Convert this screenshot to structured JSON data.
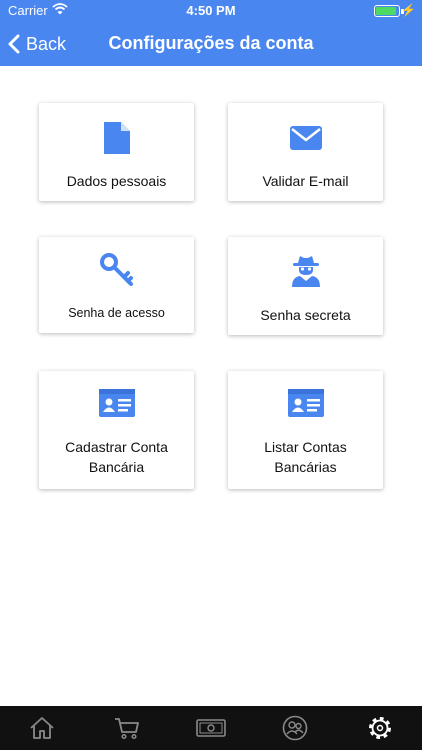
{
  "status_bar": {
    "carrier": "Carrier",
    "time": "4:50 PM",
    "battery_level": 0.95
  },
  "navbar": {
    "back_label": "Back",
    "title": "Configurações da conta"
  },
  "cards": [
    {
      "label": "Dados pessoais",
      "icon": "document-icon"
    },
    {
      "label": "Validar E-mail",
      "icon": "envelope-icon"
    },
    {
      "label": "Senha de acesso",
      "icon": "key-icon"
    },
    {
      "label": "Senha secreta",
      "icon": "spy-icon"
    },
    {
      "label": "Cadastrar Conta Bancária",
      "icon": "id-card-icon"
    },
    {
      "label": "Listar Contas Bancárias",
      "icon": "id-card-icon"
    }
  ],
  "tabbar": {
    "tabs": [
      "home-icon",
      "cart-icon",
      "money-icon",
      "users-icon",
      "settings-icon"
    ],
    "active_index": 4
  },
  "colors": {
    "accent": "#4a86f0",
    "tabbar_bg": "#111111",
    "tab_icon": "#8a8a8a",
    "tab_icon_active": "#ffffff",
    "battery_fill": "#4cd964"
  }
}
